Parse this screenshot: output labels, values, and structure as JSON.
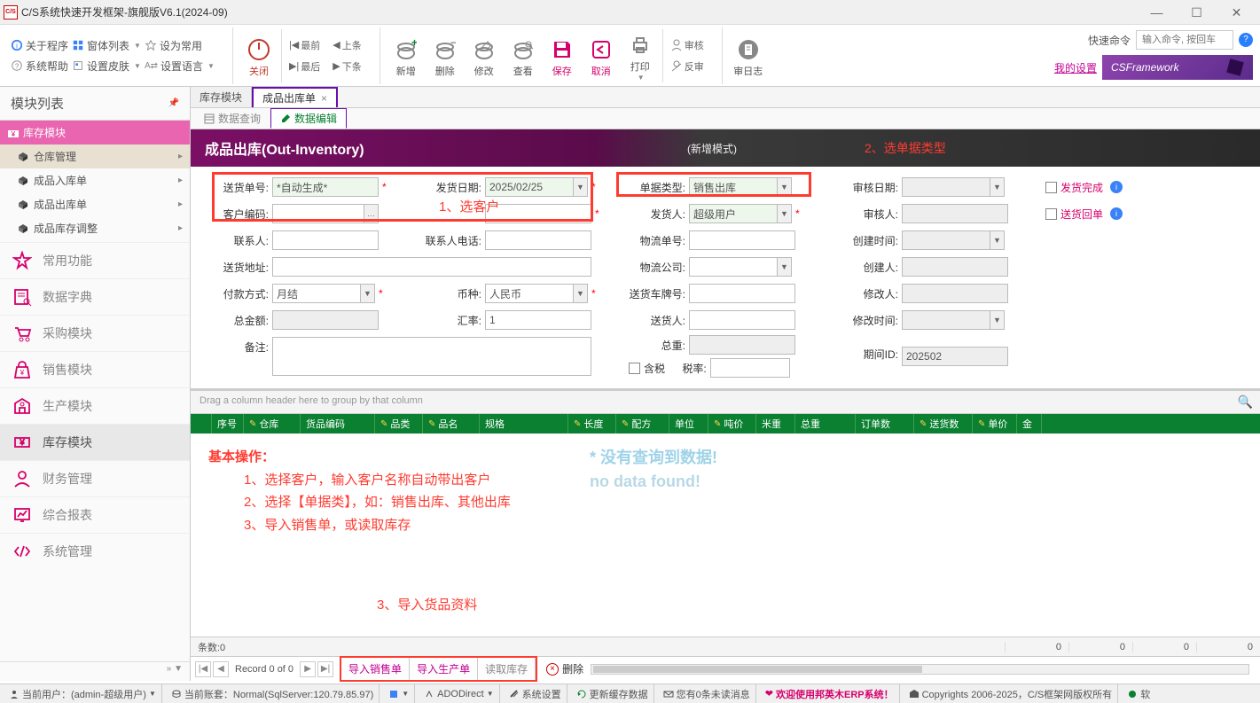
{
  "window": {
    "title": "C/S系统快速开发框架-旗舰版V6.1(2024-09)",
    "icon_text": "C/S"
  },
  "toolbar": {
    "about": "关于程序",
    "form_list": "窗体列表",
    "set_default": "设为常用",
    "sys_help": "系统帮助",
    "set_skin": "设置皮肤",
    "set_lang": "设置语言",
    "close": "关闭",
    "first": "最前",
    "prev": "上条",
    "last": "最后",
    "next": "下条",
    "add": "新增",
    "delete": "删除",
    "edit": "修改",
    "view": "查看",
    "save": "保存",
    "cancel": "取消",
    "print": "打印",
    "approve": "审核",
    "unapprove": "反审",
    "auditlog": "审日志",
    "quickcmd_label": "快速命令",
    "quickcmd_placeholder": "输入命令, 按回车",
    "my_settings": "我的设置",
    "brand": "CSFramework"
  },
  "sidebar": {
    "header": "模块列表",
    "tree_header": "库存模块",
    "items": [
      {
        "label": "仓库管理",
        "selected": true,
        "arrow": true
      },
      {
        "label": "成品入库单",
        "selected": false,
        "arrow": true
      },
      {
        "label": "成品出库单",
        "selected": false,
        "arrow": true
      },
      {
        "label": "成品库存调整",
        "selected": false,
        "arrow": true
      }
    ],
    "modules": [
      {
        "label": "常用功能",
        "icon": "star"
      },
      {
        "label": "数据字典",
        "icon": "dict"
      },
      {
        "label": "采购模块",
        "icon": "cart"
      },
      {
        "label": "销售模块",
        "icon": "bag"
      },
      {
        "label": "生产模块",
        "icon": "factory"
      },
      {
        "label": "库存模块",
        "icon": "money",
        "active": true
      },
      {
        "label": "财务管理",
        "icon": "person"
      },
      {
        "label": "综合报表",
        "icon": "report"
      },
      {
        "label": "系统管理",
        "icon": "code"
      }
    ]
  },
  "tabs": {
    "doc": [
      {
        "label": "库存模块",
        "active": false
      },
      {
        "label": "成品出库单",
        "active": true
      }
    ],
    "sub": [
      {
        "label": "数据查询",
        "active": false
      },
      {
        "label": "数据编辑",
        "active": true
      }
    ]
  },
  "page": {
    "title": "成品出库(Out-Inventory)",
    "mode": "(新增模式)",
    "anno_type": "2、选单据类型"
  },
  "form": {
    "anno_customer": "1、选客户",
    "delivery_no_label": "送货单号:",
    "delivery_no_value": "*自动生成*",
    "ship_date_label": "发货日期:",
    "ship_date_value": "2025/02/25",
    "doc_type_label": "单据类型:",
    "doc_type_value": "销售出库",
    "audit_date_label": "审核日期:",
    "ship_done_label": "发货完成",
    "customer_code_label": "客户编码:",
    "shipper_label": "发货人:",
    "shipper_value": "超级用户",
    "auditor_label": "审核人:",
    "return_label": "送货回单",
    "contact_label": "联系人:",
    "contact_tel_label": "联系人电话:",
    "logistics_no_label": "物流单号:",
    "create_time_label": "创建时间:",
    "ship_addr_label": "送货地址:",
    "logistics_co_label": "物流公司:",
    "creator_label": "创建人:",
    "pay_method_label": "付款方式:",
    "pay_method_value": "月结",
    "currency_label": "币种:",
    "currency_value": "人民币",
    "truck_no_label": "送货车牌号:",
    "editor_label": "修改人:",
    "total_label": "总金额:",
    "rate_label": "汇率:",
    "rate_value": "1",
    "deliverer_label": "送货人:",
    "edit_time_label": "修改时间:",
    "remark_label": "备注:",
    "total_weight_label": "总重:",
    "period_label": "期间ID:",
    "period_value": "202502",
    "tax_included_label": "含税",
    "tax_rate_label": "税率:"
  },
  "grid": {
    "group_hint": "Drag a column header here to group by that column",
    "columns": [
      "序号",
      "仓库",
      "货品编码",
      "品类",
      "品名",
      "规格",
      "长度",
      "配方",
      "单位",
      "吨价",
      "米重",
      "总重",
      "订单数",
      "送货数",
      "单价",
      "金"
    ],
    "editable_cols": [
      false,
      true,
      false,
      true,
      true,
      false,
      true,
      true,
      false,
      true,
      false,
      false,
      false,
      true,
      true,
      false
    ],
    "nodata1": "* 没有查询到数据!",
    "nodata2": "no data found!",
    "instructions_title": "基本操作：",
    "instructions": [
      "1、选择客户，输入客户名称自动带出客户",
      "2、选择【单据类】，如：销售出库、其他出库",
      "3、导入销售单，或读取库存"
    ],
    "anno3": "3、导入货品资料",
    "count_label": "条数:0",
    "sum_zeros": [
      "0",
      "0",
      "0",
      "0"
    ],
    "record_info": "Record 0 of 0",
    "import_sales": "导入销售单",
    "import_prod": "导入生产单",
    "read_stock": "读取库存",
    "delete": "删除"
  },
  "status": {
    "user": "当前用户：(admin-超级用户)",
    "account": "当前账套：Normal(SqlServer:120.79.85.97)",
    "ado": "ADODirect",
    "sys_settings": "系统设置",
    "refresh_cache": "更新缓存数据",
    "msg": "您有0条未读消息",
    "welcome": "欢迎使用邦英木ERP系统！",
    "copyright": "Copyrights 2006-2025，C/S框架网版权所有",
    "soft": "软"
  }
}
